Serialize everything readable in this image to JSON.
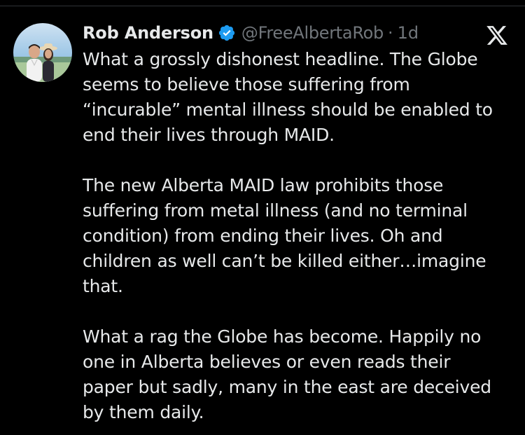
{
  "tweet": {
    "author_name": "Rob Anderson",
    "handle": "@FreeAlbertaRob",
    "separator": "·",
    "time": "1d",
    "paragraphs": [
      "What a grossly dishonest headline. The Globe\nseems to believe those suffering from\n“incurable” mental illness should be enabled to\nend their lives through MAID.",
      "The new Alberta MAID law prohibits those\nsuffering from metal illness (and no terminal\ncondition) from ending their lives. Oh and\nchildren as well can’t be killed either…imagine\nthat.",
      "What a rag the Globe has become. Happily no\none in Alberta believes or even reads their\npaper but sadly, many in the east are deceived\nby them daily."
    ]
  },
  "icons": {
    "verified": "verified-badge-icon",
    "platform": "x-logo-icon"
  },
  "colors": {
    "background": "#000000",
    "text": "#e7e9ea",
    "muted": "#71767b",
    "verified": "#1d9bf0"
  }
}
